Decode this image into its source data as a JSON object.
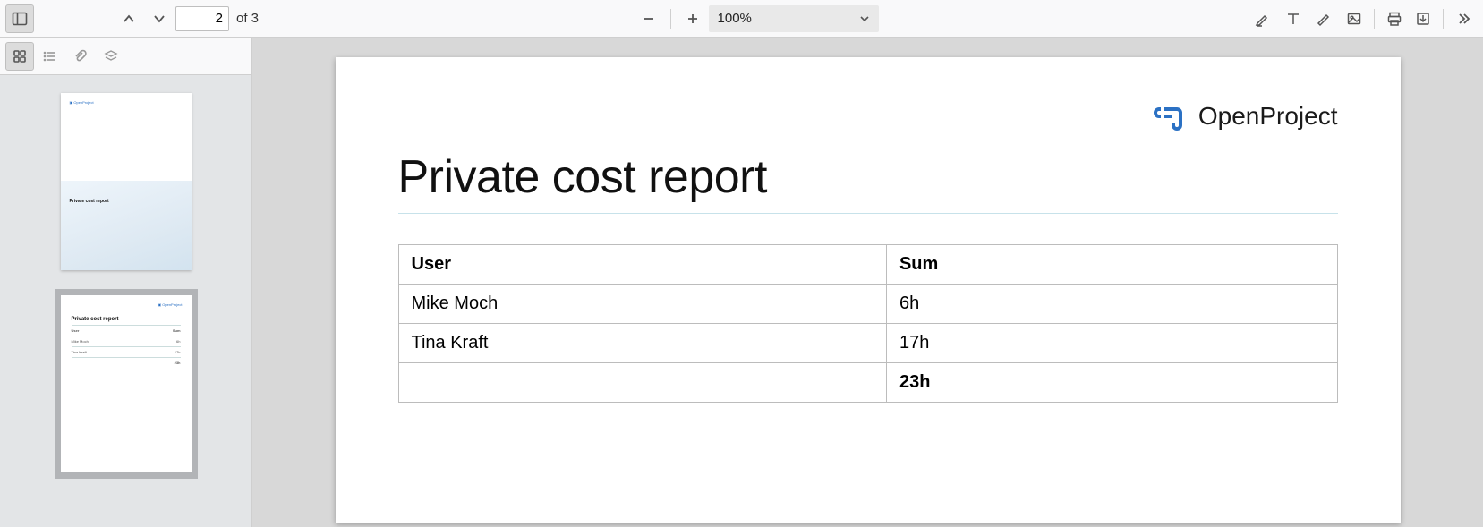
{
  "toolbar": {
    "page_current": "2",
    "page_total": "of 3",
    "zoom_label": "100%"
  },
  "brand": {
    "name": "OpenProject"
  },
  "document": {
    "title": "Private cost report",
    "table": {
      "headers": {
        "user": "User",
        "sum": "Sum"
      },
      "rows": [
        {
          "user": "Mike Moch",
          "sum": "6h"
        },
        {
          "user": "Tina Kraft",
          "sum": "17h"
        }
      ],
      "total": "23h"
    }
  },
  "thumbs": {
    "page1": {
      "title": "Private cost report"
    },
    "page2": {
      "title": "Private cost report"
    }
  }
}
